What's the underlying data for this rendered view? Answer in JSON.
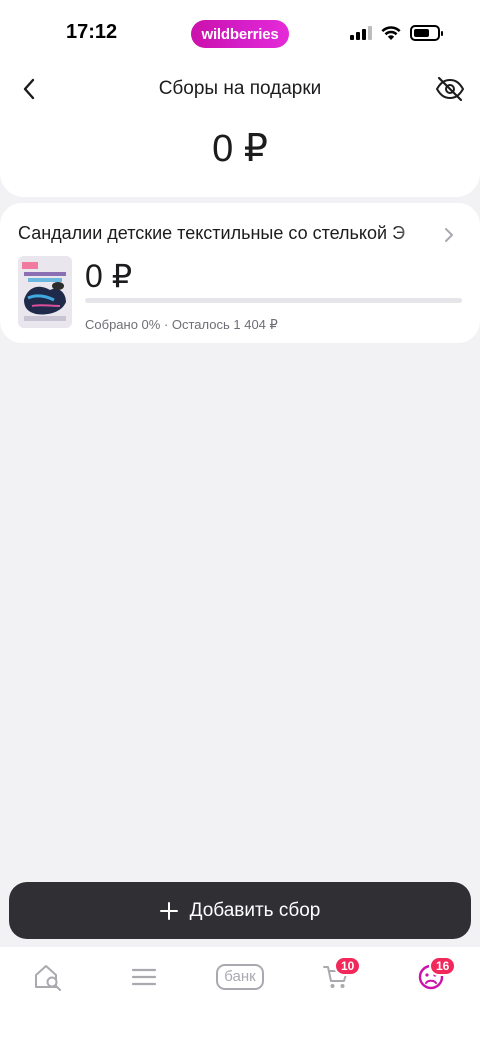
{
  "status_bar": {
    "time": "17:12",
    "brand": "wildberries"
  },
  "header": {
    "title": "Сборы на подарки",
    "total": "0 ₽"
  },
  "fund": {
    "name": "Сандалии детские текстильные со стелькой Э",
    "amount": "0 ₽",
    "progress_percent": 0,
    "status": "Собрано 0% · Осталось 1 404 ₽"
  },
  "actions": {
    "add_label": "Добавить сбор"
  },
  "tab_bar": {
    "bank_label": "банк",
    "cart_badge": "10",
    "profile_badge": "16"
  },
  "colors": {
    "accent": "#cb11ab",
    "badge": "#f2285a",
    "button": "#2f2f34",
    "background": "#f2f2f5"
  },
  "icons": [
    "back-arrow-icon",
    "eye-off-icon",
    "chevron-right-icon",
    "home-search-icon",
    "menu-icon",
    "cart-icon",
    "profile-icon",
    "wifi-icon",
    "signal-icon",
    "battery-icon"
  ]
}
